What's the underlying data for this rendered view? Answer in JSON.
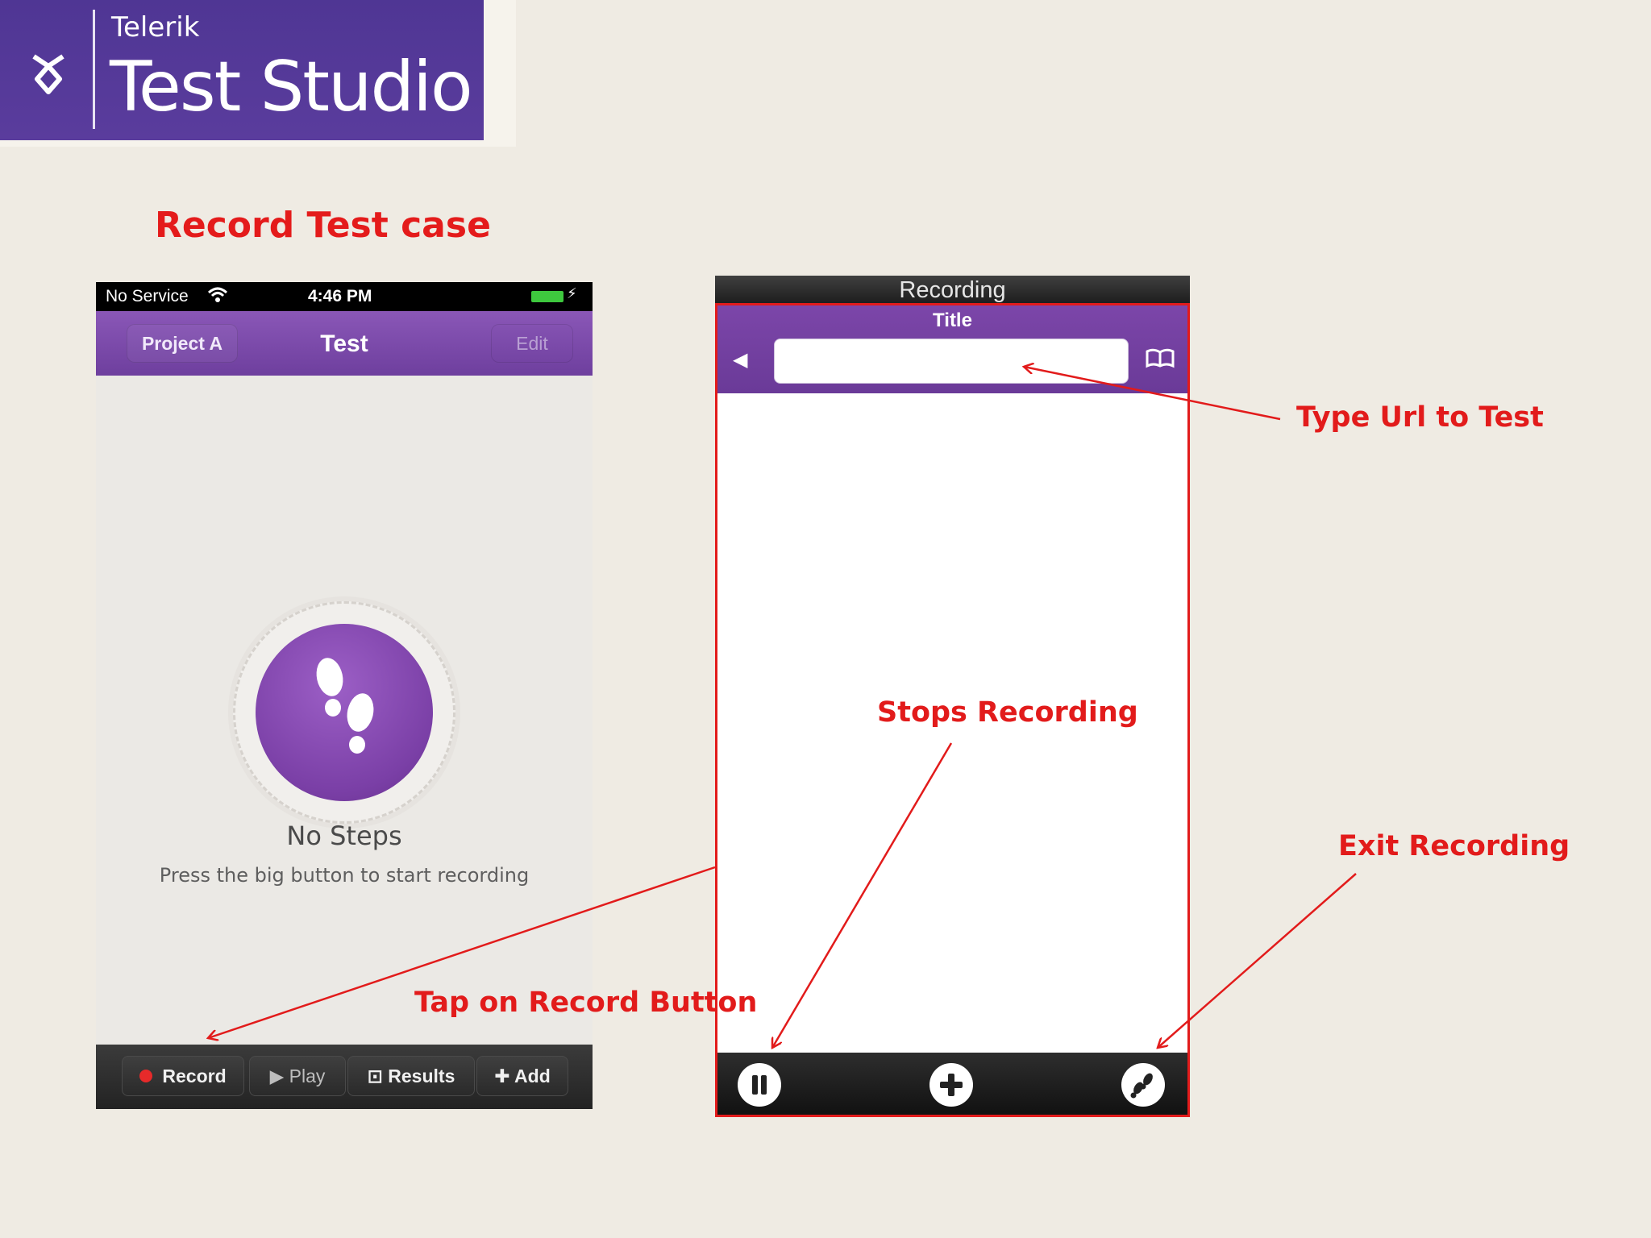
{
  "logo": {
    "brand": "Telerik",
    "product": "Test Studio"
  },
  "slide_title": "Record Test case",
  "left_phone": {
    "status_bar": {
      "carrier": "No Service",
      "time": "4:46 PM"
    },
    "nav": {
      "back_label": "Project A",
      "title": "Test",
      "edit_label": "Edit"
    },
    "empty_state": {
      "heading": "No Steps",
      "hint": "Press the big button to start recording"
    },
    "toolbar": {
      "record": "Record",
      "play": "Play",
      "results": "Results",
      "add": "Add"
    }
  },
  "right_phone": {
    "header": "Recording",
    "nav_title": "Title",
    "url_value": ""
  },
  "annotations": {
    "type_url": "Type Url to Test",
    "stops_recording": "Stops Recording",
    "exit_recording": "Exit Recording",
    "tap_record": "Tap on Record Button"
  },
  "colors": {
    "accent_purple": "#6a3a98",
    "annotation_red": "#e21b1b",
    "record_red": "#e62a2a"
  }
}
